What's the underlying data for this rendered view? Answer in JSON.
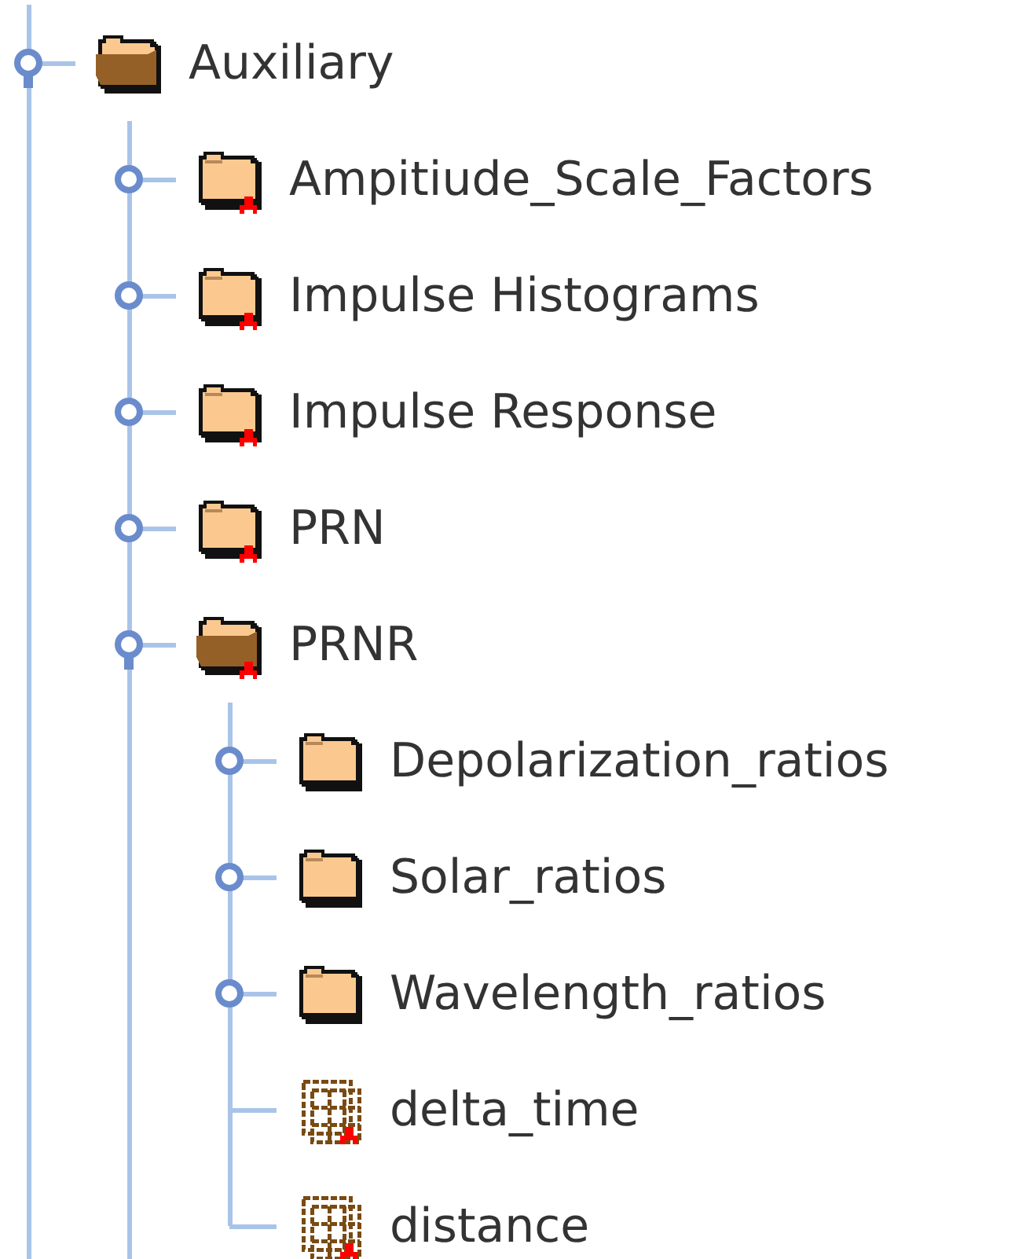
{
  "tree": [
    {
      "label": "Auxiliary",
      "kind": "group",
      "expanded": true,
      "attributes": false,
      "children": [
        {
          "label": "Ampitiude_Scale_Factors",
          "kind": "group",
          "expanded": false,
          "attributes": true
        },
        {
          "label": "Impulse Histograms",
          "kind": "group",
          "expanded": false,
          "attributes": true
        },
        {
          "label": "Impulse Response",
          "kind": "group",
          "expanded": false,
          "attributes": true
        },
        {
          "label": "PRN",
          "kind": "group",
          "expanded": false,
          "attributes": true
        },
        {
          "label": "PRNR",
          "kind": "group",
          "expanded": true,
          "attributes": true,
          "children": [
            {
              "label": "Depolarization_ratios",
              "kind": "group",
              "expanded": false,
              "attributes": false
            },
            {
              "label": "Solar_ratios",
              "kind": "group",
              "expanded": false,
              "attributes": false
            },
            {
              "label": "Wavelength_ratios",
              "kind": "group",
              "expanded": false,
              "attributes": false
            },
            {
              "label": "delta_time",
              "kind": "dataset",
              "attributes": true
            },
            {
              "label": "distance",
              "kind": "dataset",
              "attributes": true
            }
          ]
        }
      ]
    }
  ]
}
